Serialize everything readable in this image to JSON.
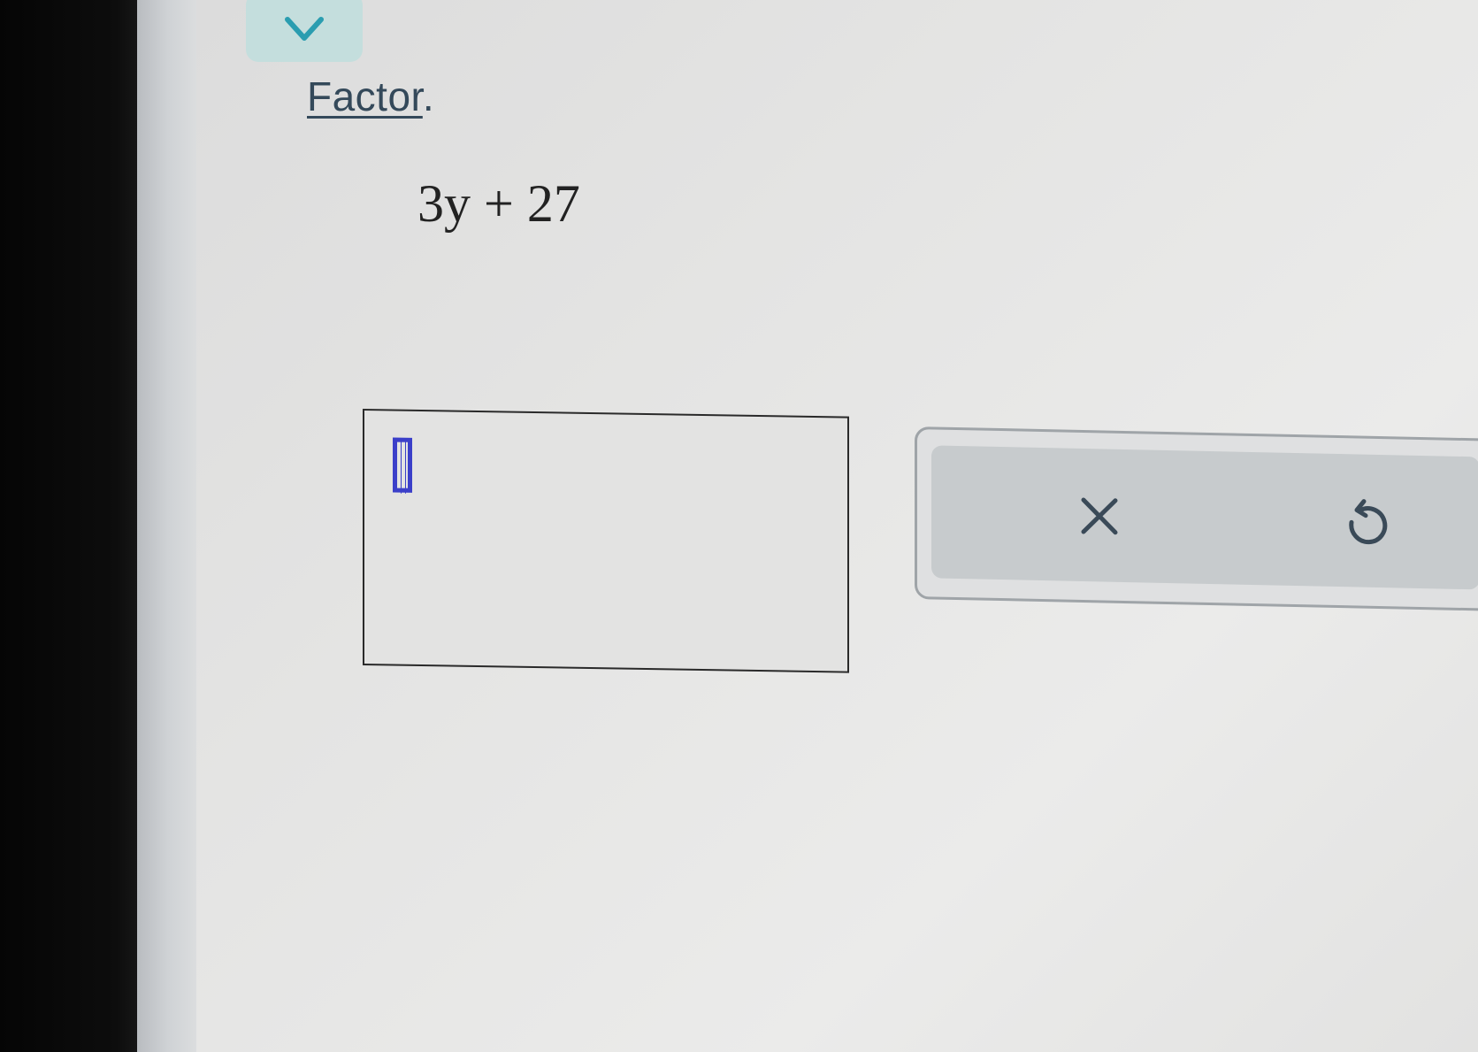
{
  "collapse": {
    "icon": "chevron-down-icon",
    "color": "#2a9db0"
  },
  "question": {
    "instruction_link": "Factor",
    "instruction_suffix": ".",
    "expression": "3y + 27"
  },
  "answer": {
    "value": ""
  },
  "toolbar": {
    "clear_icon": "close-icon",
    "undo_icon": "undo-icon"
  }
}
